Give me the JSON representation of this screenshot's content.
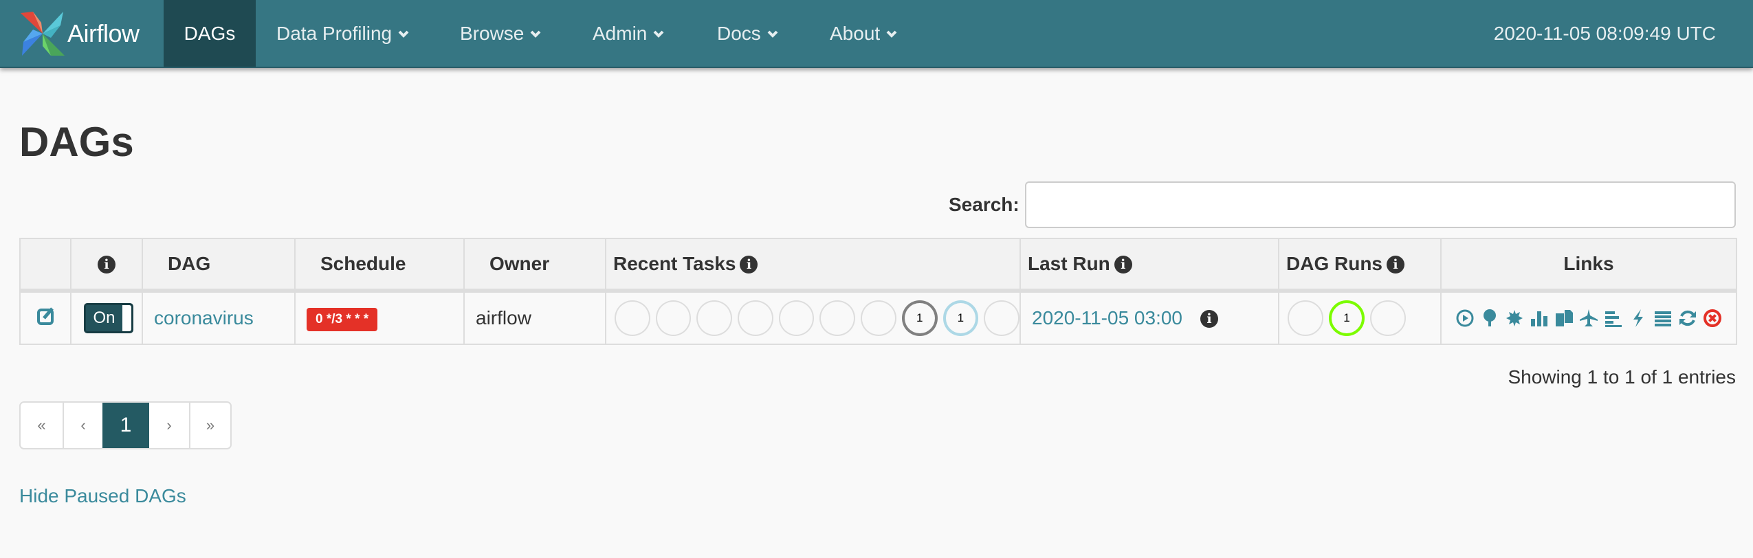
{
  "app": {
    "brand": "Airflow",
    "clock": "2020-11-05 08:09:49 UTC"
  },
  "nav": {
    "items": [
      {
        "label": "DAGs",
        "active": true,
        "dropdown": false
      },
      {
        "label": "Data Profiling",
        "dropdown": true
      },
      {
        "label": "Browse",
        "dropdown": true
      },
      {
        "label": "Admin",
        "dropdown": true
      },
      {
        "label": "Docs",
        "dropdown": true
      },
      {
        "label": "About",
        "dropdown": true
      }
    ]
  },
  "page": {
    "title": "DAGs"
  },
  "search": {
    "label": "Search:",
    "value": ""
  },
  "table": {
    "headers": {
      "info": "info-icon",
      "dag": "DAG",
      "schedule": "Schedule",
      "owner": "Owner",
      "recent_tasks": "Recent Tasks",
      "last_run": "Last Run",
      "dag_runs": "DAG Runs",
      "links": "Links"
    },
    "rows": [
      {
        "toggle": "On",
        "dag": "coronavirus",
        "schedule": "0 */3 * * *",
        "owner": "airflow",
        "recent_tasks": [
          {
            "state": "success",
            "count": ""
          },
          {
            "state": "running",
            "count": ""
          },
          {
            "state": "failed",
            "count": ""
          },
          {
            "state": "upstream_failed",
            "count": ""
          },
          {
            "state": "skipped",
            "count": ""
          },
          {
            "state": "up_for_retry",
            "count": ""
          },
          {
            "state": "up_for_reschedule",
            "count": ""
          },
          {
            "state": "queued",
            "count": "1",
            "color": "#808080"
          },
          {
            "state": "none",
            "count": "1",
            "color": "#add8e6"
          },
          {
            "state": "scheduled",
            "count": ""
          }
        ],
        "last_run": "2020-11-05 03:00",
        "dag_runs": [
          {
            "state": "success",
            "count": ""
          },
          {
            "state": "running",
            "count": "1",
            "color": "#7cfc00"
          },
          {
            "state": "failed",
            "count": ""
          }
        ],
        "links": [
          "trigger-dag-icon",
          "tree-view-icon",
          "graph-view-icon",
          "task-duration-icon",
          "task-tries-icon",
          "landing-times-icon",
          "gantt-icon",
          "code-icon",
          "logs-icon",
          "refresh-icon",
          "delete-dag-icon"
        ]
      }
    ]
  },
  "footer": {
    "showing": "Showing 1 to 1 of 1 entries",
    "pagination": [
      "«",
      "‹",
      "1",
      "›",
      "»"
    ],
    "current_page": "1",
    "hide_paused": "Hide Paused DAGs"
  },
  "colors": {
    "navbar": "#367683",
    "accent": "#3a8a9c",
    "active_nav": "#1f4a52",
    "schedule_badge": "#e43127",
    "delete": "#e43127"
  }
}
